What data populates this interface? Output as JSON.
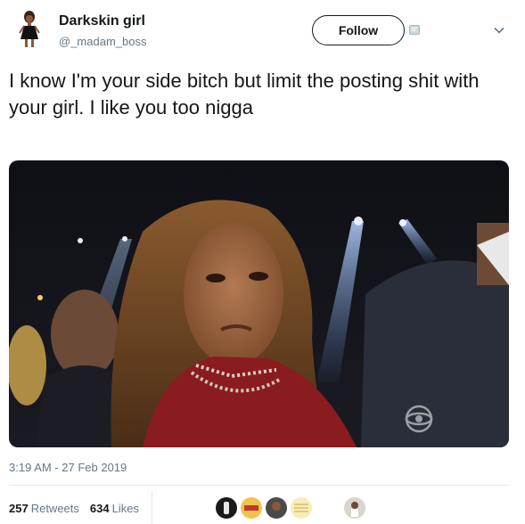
{
  "user": {
    "name": "Darkskin girl",
    "handle": "@_madam_boss",
    "avatar_icon": "girl-black-dress-avatar"
  },
  "header": {
    "follow_label": "Follow",
    "badge_icon": "translator-badge-icon",
    "more_icon": "chevron-down-icon"
  },
  "tweet": {
    "text": "I know I'm your side bitch but limit the posting shit with your girl. I like you too nigga",
    "timestamp": "3:19 AM - 27 Feb 2019"
  },
  "stats": {
    "retweets_count": "257",
    "retweets_label": "Retweets",
    "likes_count": "634",
    "likes_label": "Likes"
  },
  "likers": [
    {
      "icon": "liker-avatar-icon-1"
    },
    {
      "icon": "liker-avatar-icon-2"
    },
    {
      "icon": "liker-avatar-icon-3"
    },
    {
      "icon": "liker-avatar-icon-4"
    },
    {
      "icon": "liker-avatar-icon-5"
    }
  ],
  "colors": {
    "text_primary": "#14171a",
    "text_secondary": "#657786",
    "divider": "#e1e8ed"
  }
}
